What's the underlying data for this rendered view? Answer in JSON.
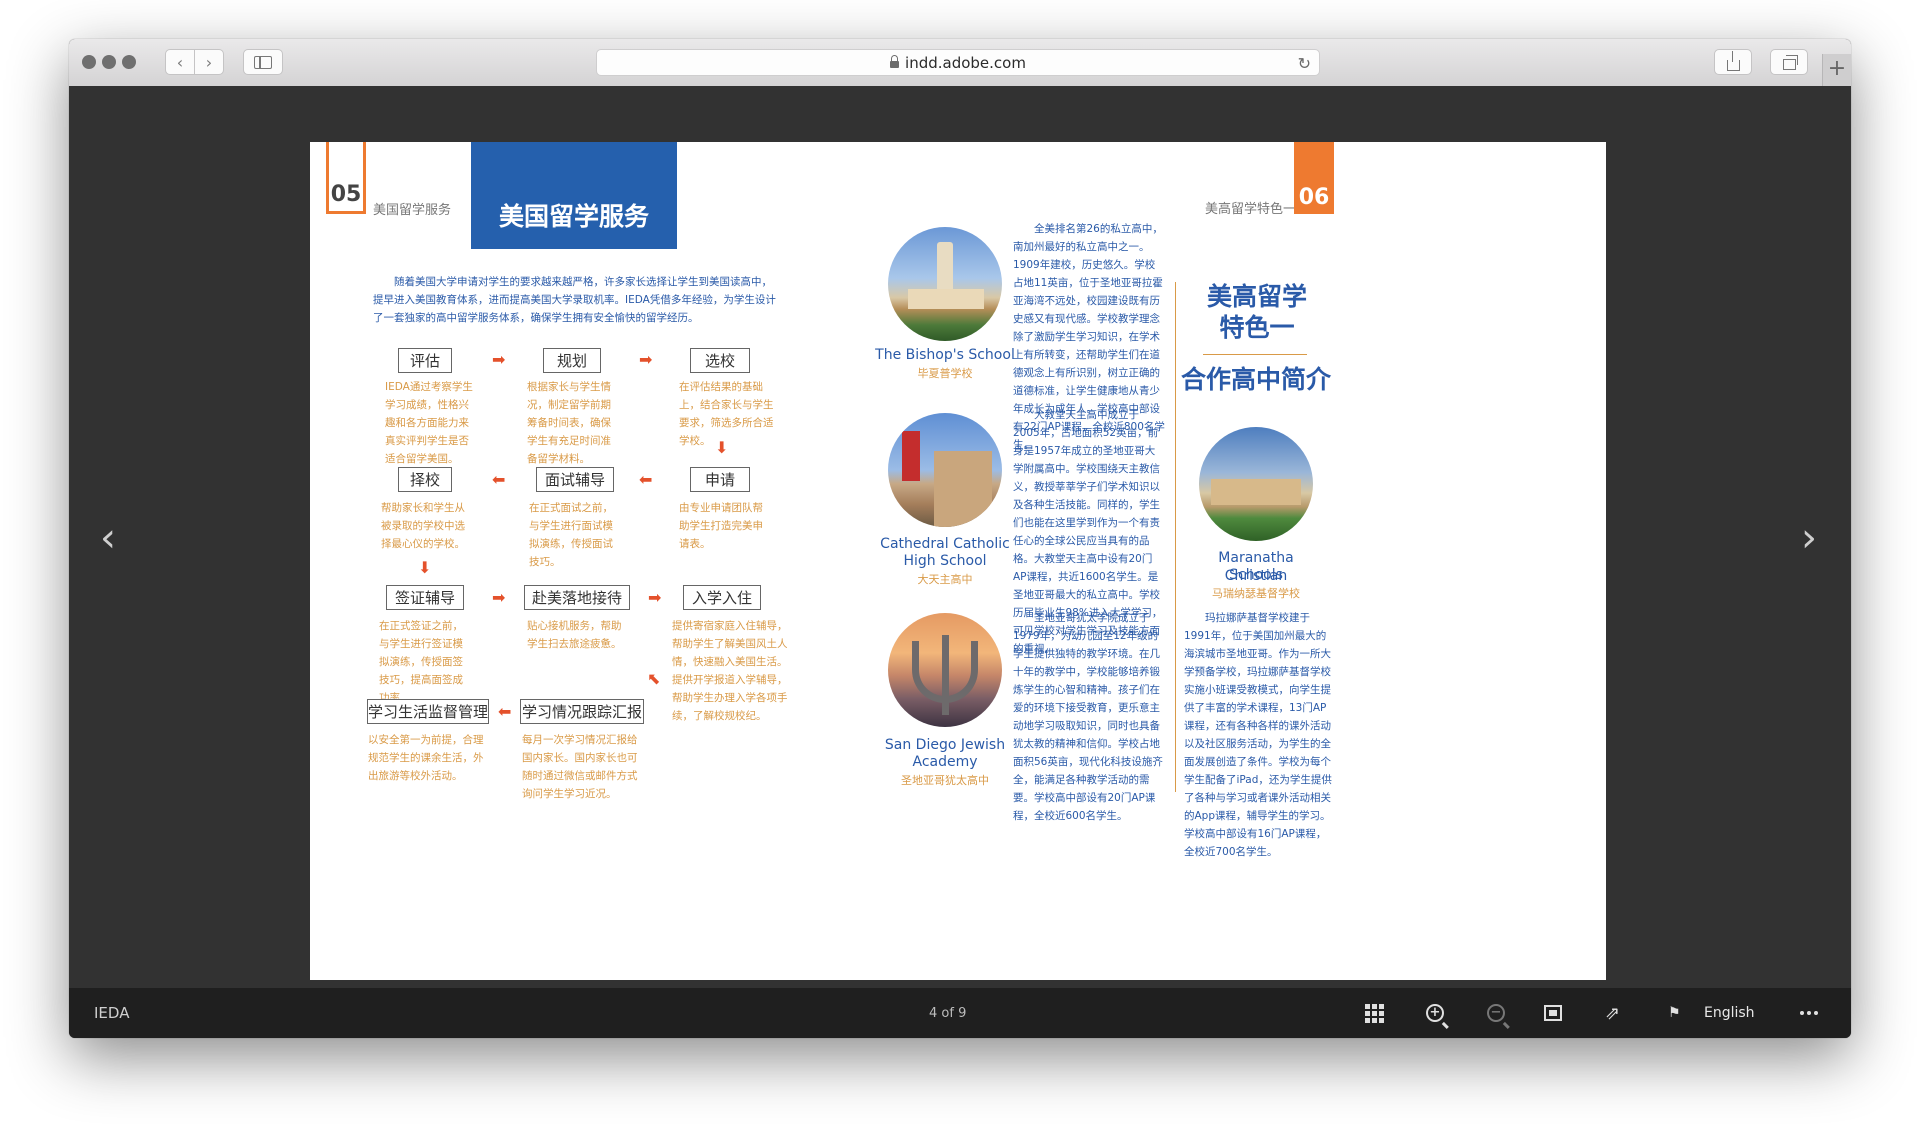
{
  "browser": {
    "url": "indd.adobe.com",
    "new_tab": "+"
  },
  "viewer": {
    "brand": "IEDA",
    "page_indicator": "4 of 9",
    "language": "English",
    "prev_icon": "‹",
    "next_icon": "›"
  },
  "left_page": {
    "page_number": "05",
    "section_label": "美国留学服务",
    "banner_title": "美国留学服务",
    "intro": "随着美国大学申请对学生的要求越来越严格，许多家长选择让学生到美国读高中，提早进入美国教育体系，进而提高美国大学录取机率。IEDA凭借多年经验，为学生设计了一套独家的高中留学服务体系，确保学生拥有安全愉快的留学经历。",
    "steps": [
      {
        "label": "评估",
        "desc": "IEDA通过考察学生学习成绩，性格兴趣和各方面能力来真实评判学生是否适合留学美国。"
      },
      {
        "label": "规划",
        "desc": "根据家长与学生情况，制定留学前期筹备时间表，确保学生有充足时间准备留学材料。"
      },
      {
        "label": "选校",
        "desc": "在评估结果的基础上，结合家长与学生要求，筛选多所合适学校。"
      },
      {
        "label": "申请",
        "desc": "由专业申请团队帮助学生打造完美申请表。"
      },
      {
        "label": "面试辅导",
        "desc": "在正式面试之前，与学生进行面试模拟演练，传授面试技巧。"
      },
      {
        "label": "择校",
        "desc": "帮助家长和学生从被录取的学校中选择最心仪的学校。"
      },
      {
        "label": "签证辅导",
        "desc": "在正式签证之前，与学生进行签证模拟演练，传授面签技巧，提高面签成功率。"
      },
      {
        "label": "赴美落地接待",
        "desc": "贴心接机服务，帮助学生扫去旅途疲惫。"
      },
      {
        "label": "入学入住",
        "desc": "提供寄宿家庭入住辅导，帮助学生了解美国风土人情，快速融入美国生活。提供开学报道入学辅导，帮助学生办理入学各项手续，了解校规校纪。"
      },
      {
        "label": "学习情况跟踪汇报",
        "desc": "每月一次学习情况汇报给国内家长。国内家长也可随时通过微信或邮件方式询问学生学习近况。"
      },
      {
        "label": "学习生活监督管理",
        "desc": "以安全第一为前提，合理规范学生的课余生活，外出旅游等校外活动。"
      }
    ]
  },
  "right_page": {
    "page_number": "06",
    "section_label": "美高留学特色一",
    "feature_title_line1": "美高留学",
    "feature_title_line2": "特色一",
    "feature_subtitle": "合作高中简介",
    "schools": [
      {
        "name": "The Bishop's School",
        "cn_name": "毕夏普学校",
        "text": "全美排名第26的私立高中，南加州最好的私立高中之一。1909年建校，历史悠久。学校占地11英亩，位于圣地亚哥拉霍亚海湾不远处，校园建设既有历史感又有现代感。学校教学理念除了激励学生学习知识，在学术上有所转变，还帮助学生们在道德观念上有所识别，树立正确的道德标准，让学生健康地从青少年成长为成年人。学校高中部设有22门AP课程，全校近800名学生。"
      },
      {
        "name_line1": "Cathedral Catholic",
        "name_line2": "High School",
        "cn_name": "大天主高中",
        "text": "大教堂天主高中成立于2005年，占地面积52英亩，前身是1957年成立的圣地亚哥大学附属高中。学校围绕天主教信义，教授莘莘学子们学术知识以及各种生活技能。同样的，学生们也能在这里学到作为一个有责任心的全球公民应当具有的品格。大教堂天主高中设有20门AP课程，共近1600名学生。是圣地亚哥最大的私立高中。学校历届毕业生98%进入大学学习，可见学校对学生学习及技能方面的重视。"
      },
      {
        "name_line1": "San Diego Jewish",
        "name_line2": "Academy",
        "cn_name": "圣地亚哥犹太高中",
        "text": "圣地亚哥犹太学院成立于1979年，为幼儿园至12年级的学生提供独特的教学环境。在几十年的教学中，学校能够培养锻炼学生的心智和精神。孩子们在爱的环境下接受教育，更乐意主动地学习吸取知识，同时也具备犹太教的精神和信仰。学校占地面积56英亩，现代化科技设施齐全，能满足各种教学活动的需要。学校高中部设有20门AP课程，全校近600名学生。"
      },
      {
        "name_line1": "Maranatha Christian",
        "name_line2": "Schools",
        "cn_name": "马瑞纳瑟基督学校",
        "text": "玛拉娜萨基督学校建于1991年，位于美国加州最大的海滨城市圣地亚哥。作为一所大学预备学校，玛拉娜萨基督学校实施小班课受教模式，向学生提供了丰富的学术课程，13门AP课程，还有各种各样的课外活动以及社区服务活动，为学生的全面发展创造了条件。学校为每个学生配备了iPad，还为学生提供了各种与学习或者课外活动相关的App课程，辅导学生的学习。学校高中部设有16门AP课程，全校近700名学生。"
      }
    ]
  },
  "colors": {
    "accent_orange": "#ee7a30",
    "banner_blue": "#2560ad",
    "text_blue": "#2a5aa8",
    "desc_gold": "#d99a47",
    "arrow_red": "#e4512b"
  }
}
